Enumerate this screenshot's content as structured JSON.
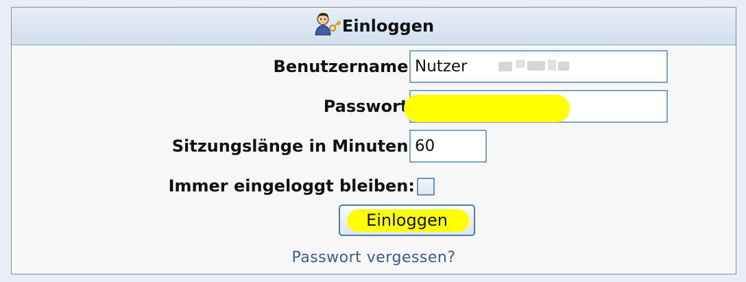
{
  "header": {
    "title": "Einloggen",
    "icon": "user-key-icon"
  },
  "form": {
    "username_label": "Benutzername:",
    "username_value": "Nutzer",
    "password_label": "Passwort:",
    "password_value": "",
    "session_label": "Sitzungslänge in Minuten:",
    "session_value": "60",
    "remember_label": "Immer eingeloggt bleiben:",
    "remember_checked": false,
    "submit_label": "Einloggen",
    "forgot_label": "Passwort vergessen?"
  },
  "colors": {
    "highlight": "#ffff00",
    "link": "#3b5b8e",
    "field_border": "#7ea2c7"
  }
}
